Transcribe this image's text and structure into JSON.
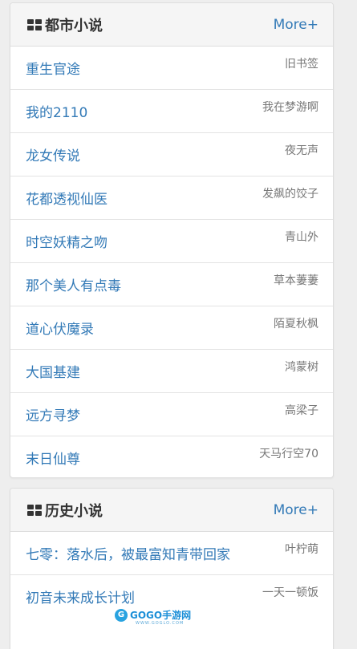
{
  "urban_section": {
    "title": "都市小说",
    "more_label": "More+",
    "items": [
      {
        "title": "重生官途",
        "author": "旧书签"
      },
      {
        "title": "我的2110",
        "author": "我在梦游啊"
      },
      {
        "title": "龙女传说",
        "author": "夜无声"
      },
      {
        "title": "花都透视仙医",
        "author": "发飙的饺子"
      },
      {
        "title": "时空妖精之吻",
        "author": "青山外"
      },
      {
        "title": "那个美人有点毒",
        "author": "草本萋萋"
      },
      {
        "title": "道心伏魔录",
        "author": "陌夏秋枫"
      },
      {
        "title": "大国基建",
        "author": "鸿蒙树"
      },
      {
        "title": "远方寻梦",
        "author": "高梁子"
      },
      {
        "title": "末日仙尊",
        "author": "天马行空70"
      }
    ]
  },
  "history_section": {
    "title": "历史小说",
    "more_label": "More+",
    "items": [
      {
        "title": "七零：落水后，被最富知青带回家",
        "author": "叶柠萌"
      },
      {
        "title": "初音未来成长计划",
        "author": "一天一顿饭"
      }
    ]
  },
  "watermark": {
    "logo_text": "GOGO手游网",
    "sub_text": "WWW.GOGLO.COM"
  },
  "colors": {
    "link": "#337ab7",
    "heading_bg": "#f5f5f5",
    "page_bg": "#eeeeee"
  }
}
